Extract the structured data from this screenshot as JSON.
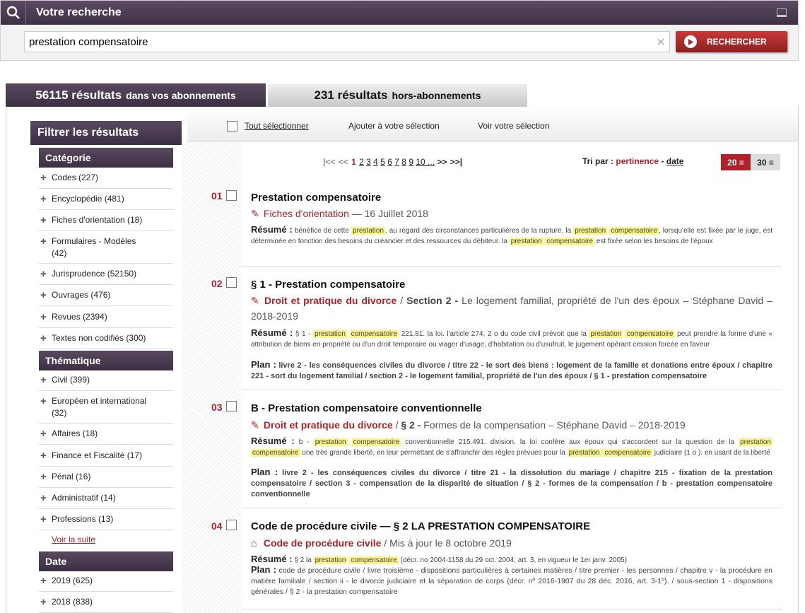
{
  "search": {
    "title": "Votre recherche",
    "query": "prestation compensatoire",
    "button": "RECHERCHER"
  },
  "tabs": [
    {
      "count": "56115 résultats",
      "label": "dans vos abonnements"
    },
    {
      "count": "231 résultats",
      "label": "hors-abonnements"
    }
  ],
  "toolbar": {
    "select_all": "Tout sélectionner",
    "add": "Ajouter à votre sélection",
    "view": "Voir votre sélection"
  },
  "filters": {
    "title": "Filtrer les résultats",
    "categorie_title": "Catégorie",
    "categorie": [
      "Codes (227)",
      "Encyclopédie (481)",
      "Fiches d'orientation (18)",
      "Formulaires - Modèles (42)",
      "Jurisprudence (52150)",
      "Ouvrages (476)",
      "Revues (2394)",
      "Textes non codifiés (300)"
    ],
    "thematique_title": "Thématique",
    "thematique": [
      "Civil (399)",
      "Européen et international (32)",
      "Affaires (18)",
      "Finance et Fiscalité (17)",
      "Pénal (16)",
      "Administratif (14)",
      "Professions (13)"
    ],
    "voir_suite": "Voir la suite",
    "date_title": "Date",
    "date": [
      "2019 (625)",
      "2018 (838)"
    ]
  },
  "pagination": {
    "first": "|<<",
    "prev": "<<",
    "pages": [
      "1",
      "2",
      "3",
      "4",
      "5",
      "6",
      "7",
      "8",
      "9",
      "10 ..."
    ],
    "current": "1",
    "next": ">>",
    "last": ">>|"
  },
  "sort": {
    "label": "Tri par :",
    "pertinence": "pertinence",
    "dash": "-",
    "date": "date",
    "per_page": [
      "20",
      "30"
    ]
  },
  "results": [
    {
      "num": "01",
      "title": "Prestation compensatoire",
      "source": "Fiches d'orientation",
      "source_rest": " — 16 Juillet 2018",
      "resume_label": "Résumé :",
      "resume_html": "bénéfice de cette <span class='hl'>prestation</span>, au regard des circonstances particulières de la rupture. la <span class='hl'>prestation</span> <span class='hl'>compensatoire</span>, lorsqu'elle est fixée par le juge, est déterminée en fonction des besoins du créancier et des ressources du débiteur. la <span class='hl'>prestation</span> <span class='hl'>compensatoire</span> est fixée selon les besoins de l'époux"
    },
    {
      "num": "02",
      "title": "§ 1 - Prestation compensatoire",
      "source": "Droit et pratique du divorce",
      "source_sep": " / ",
      "source_section": "Section 2 -",
      "source_rest": " Le logement familial, propriété de l'un des époux – Stéphane David – 2018-2019",
      "resume_label": "Résumé :",
      "resume_html": "§ 1 - <span class='hl'>prestation</span> <span class='hl'>compensatoire</span> 221.81. la loi. l'article 274, 2 o du code civil prévoit que la <span class='hl'>prestation</span> <span class='hl'>compensatoire</span> peut prendre la forme d'une « attribution de biens en propriété ou d'un droit temporaire ou viager d'usage, d'habitation ou d'usufruit, le jugement opérant cession forcée en faveur",
      "plan_label": "Plan :",
      "plan": "livre 2 - les conséquences civiles du divorce / titre 22 - le sort des biens : logement de la famille et donations entre époux / chapitre 221 - sort du logement familial / section 2 - le logement familial, propriété de l'un des époux / § 1 - prestation compensatoire"
    },
    {
      "num": "03",
      "title": "B - Prestation compensatoire conventionnelle",
      "source": "Droit et pratique du divorce",
      "source_sep": " / ",
      "source_section": "§ 2 -",
      "source_rest": " Formes de la compensation – Stéphane David – 2018-2019",
      "resume_label": "Résumé :",
      "resume_html": "b - <span class='hl'>prestation</span> <span class='hl'>compensatoire</span> conventionnelle 215.491. division. la loi confère aux époux qui s'accordent sur la question de la <span class='hl'>prestation</span> <span class='hl'>compensatoire</span> une très grande liberté, en leur permettant de s'affranchir des règles prévues pour la <span class='hl'>prestation</span> <span class='hl'>compensatoire</span> judiciaire (1 o ). en usant de la liberté",
      "plan_label": "Plan :",
      "plan": "livre 2 - les conséquences civiles du divorce / titre 21 - la dissolution du mariage / chapitre 215 - fixation de la prestation compensatoire / section 3 - compensation de la disparité de situation / § 2 - formes de la compensation / b - prestation compensatoire conventionnelle"
    },
    {
      "num": "04",
      "title": "Code de procédure civile — § 2 LA PRESTATION COMPENSATOIRE",
      "source": "Code de procédure civile",
      "source_sep": " / ",
      "source_rest": "Mis à jour le 8 octobre 2019",
      "resume_label": "Résumé :",
      "resume_html": "§ 2 la <span class='hl'>prestation</span> <span class='hl'>compensatoire</span> (décr. no 2004-1158 du 29 oct. 2004, art. 3, en vigueur le 1er janv. 2005)",
      "plan_label": "Plan :",
      "plan": "code de procédure civile / livre troisième - dispositions particulières à certaines matières / titre premier - les personnes / chapitre v - la procédure en matière familiale / section ii - le divorce judiciaire et la séparation de corps (décr. nº 2016-1907 du 28 déc. 2016, art. 3-1º). / sous-section 1 - dispositions générales / § 2 - la prestation compensatoire"
    }
  ]
}
